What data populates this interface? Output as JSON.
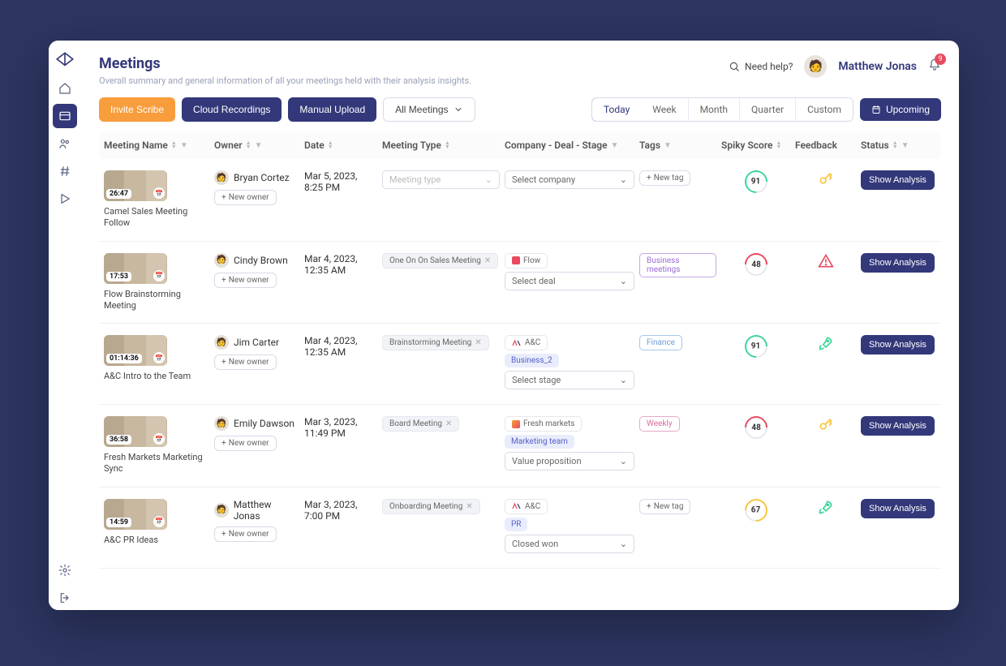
{
  "header": {
    "title": "Meetings",
    "subtitle": "Overall summary and general information of all your meetings held with their analysis insights.",
    "help": "Need help?",
    "user": "Matthew Jonas",
    "notif_count": "9"
  },
  "toolbar": {
    "invite": "Invite Scribe",
    "cloud": "Cloud Recordings",
    "upload": "Manual Upload",
    "filter": "All Meetings",
    "upcoming": "Upcoming"
  },
  "segments": [
    "Today",
    "Week",
    "Month",
    "Quarter",
    "Custom"
  ],
  "columns": {
    "name": "Meeting Name",
    "owner": "Owner",
    "date": "Date",
    "type": "Meeting Type",
    "comp": "Company - Deal - Stage",
    "tags": "Tags",
    "score": "Spiky Score",
    "feedback": "Feedback",
    "status": "Status"
  },
  "labels": {
    "new_owner": "New owner",
    "new_tag": "New tag",
    "meeting_type_ph": "Meeting type",
    "select_company": "Select company",
    "select_deal": "Select deal",
    "select_stage": "Select stage",
    "show_analysis": "Show Analysis"
  },
  "rows": [
    {
      "time": "26:47",
      "title": "Camel Sales Meeting Follow",
      "owner": "Bryan Cortez",
      "date1": "Mar 5, 2023,",
      "date2": "8:25 PM",
      "type_pill": "",
      "companies": [],
      "deals": [],
      "stage": "",
      "tags": [],
      "score": "91",
      "ring": "green",
      "feedback": "key"
    },
    {
      "time": "17:53",
      "title": "Flow Brainstorming Meeting",
      "owner": "Cindy Brown",
      "date1": "Mar 4, 2023,",
      "date2": "12:35 AM",
      "type_pill": "One On On Sales Meeting",
      "companies": [
        {
          "kind": "red",
          "label": "Flow"
        }
      ],
      "deals": [],
      "stage": "",
      "tags": [
        {
          "cls": "tag-purple",
          "label": "Business meetings"
        }
      ],
      "score": "48",
      "ring": "red",
      "feedback": "warn"
    },
    {
      "time": "01:14:36",
      "title": "A&C Intro to the Team",
      "owner": "Jim Carter",
      "date1": "Mar 4, 2023,",
      "date2": "12:35 AM",
      "type_pill": "Brainstorming Meeting",
      "companies": [
        {
          "kind": "ac",
          "label": "A&C"
        }
      ],
      "deals": [
        "Business_2"
      ],
      "stage": "",
      "tags": [
        {
          "cls": "tag-finance",
          "label": "Finance"
        }
      ],
      "score": "91",
      "ring": "green",
      "feedback": "rocket"
    },
    {
      "time": "36:58",
      "title": "Fresh Markets Marketing Sync",
      "owner": "Emily Dawson",
      "date1": "Mar 3, 2023,",
      "date2": "11:49 PM",
      "type_pill": "Board Meeting",
      "companies": [
        {
          "kind": "fresh",
          "label": "Fresh markets"
        }
      ],
      "deals": [
        "Marketing team"
      ],
      "stage": "Value proposition",
      "tags": [
        {
          "cls": "tag-weekly",
          "label": "Weekly"
        }
      ],
      "score": "48",
      "ring": "red",
      "feedback": "key"
    },
    {
      "time": "14:59",
      "title": "A&C PR Ideas",
      "owner": "Matthew Jonas",
      "date1": "Mar 3, 2023,",
      "date2": "7:00 PM",
      "type_pill": "Onboarding Meeting",
      "companies": [
        {
          "kind": "ac",
          "label": "A&C"
        }
      ],
      "deals": [
        "PR"
      ],
      "stage": "Closed won",
      "tags": [],
      "score": "67",
      "ring": "yellow",
      "feedback": "rocket"
    }
  ]
}
